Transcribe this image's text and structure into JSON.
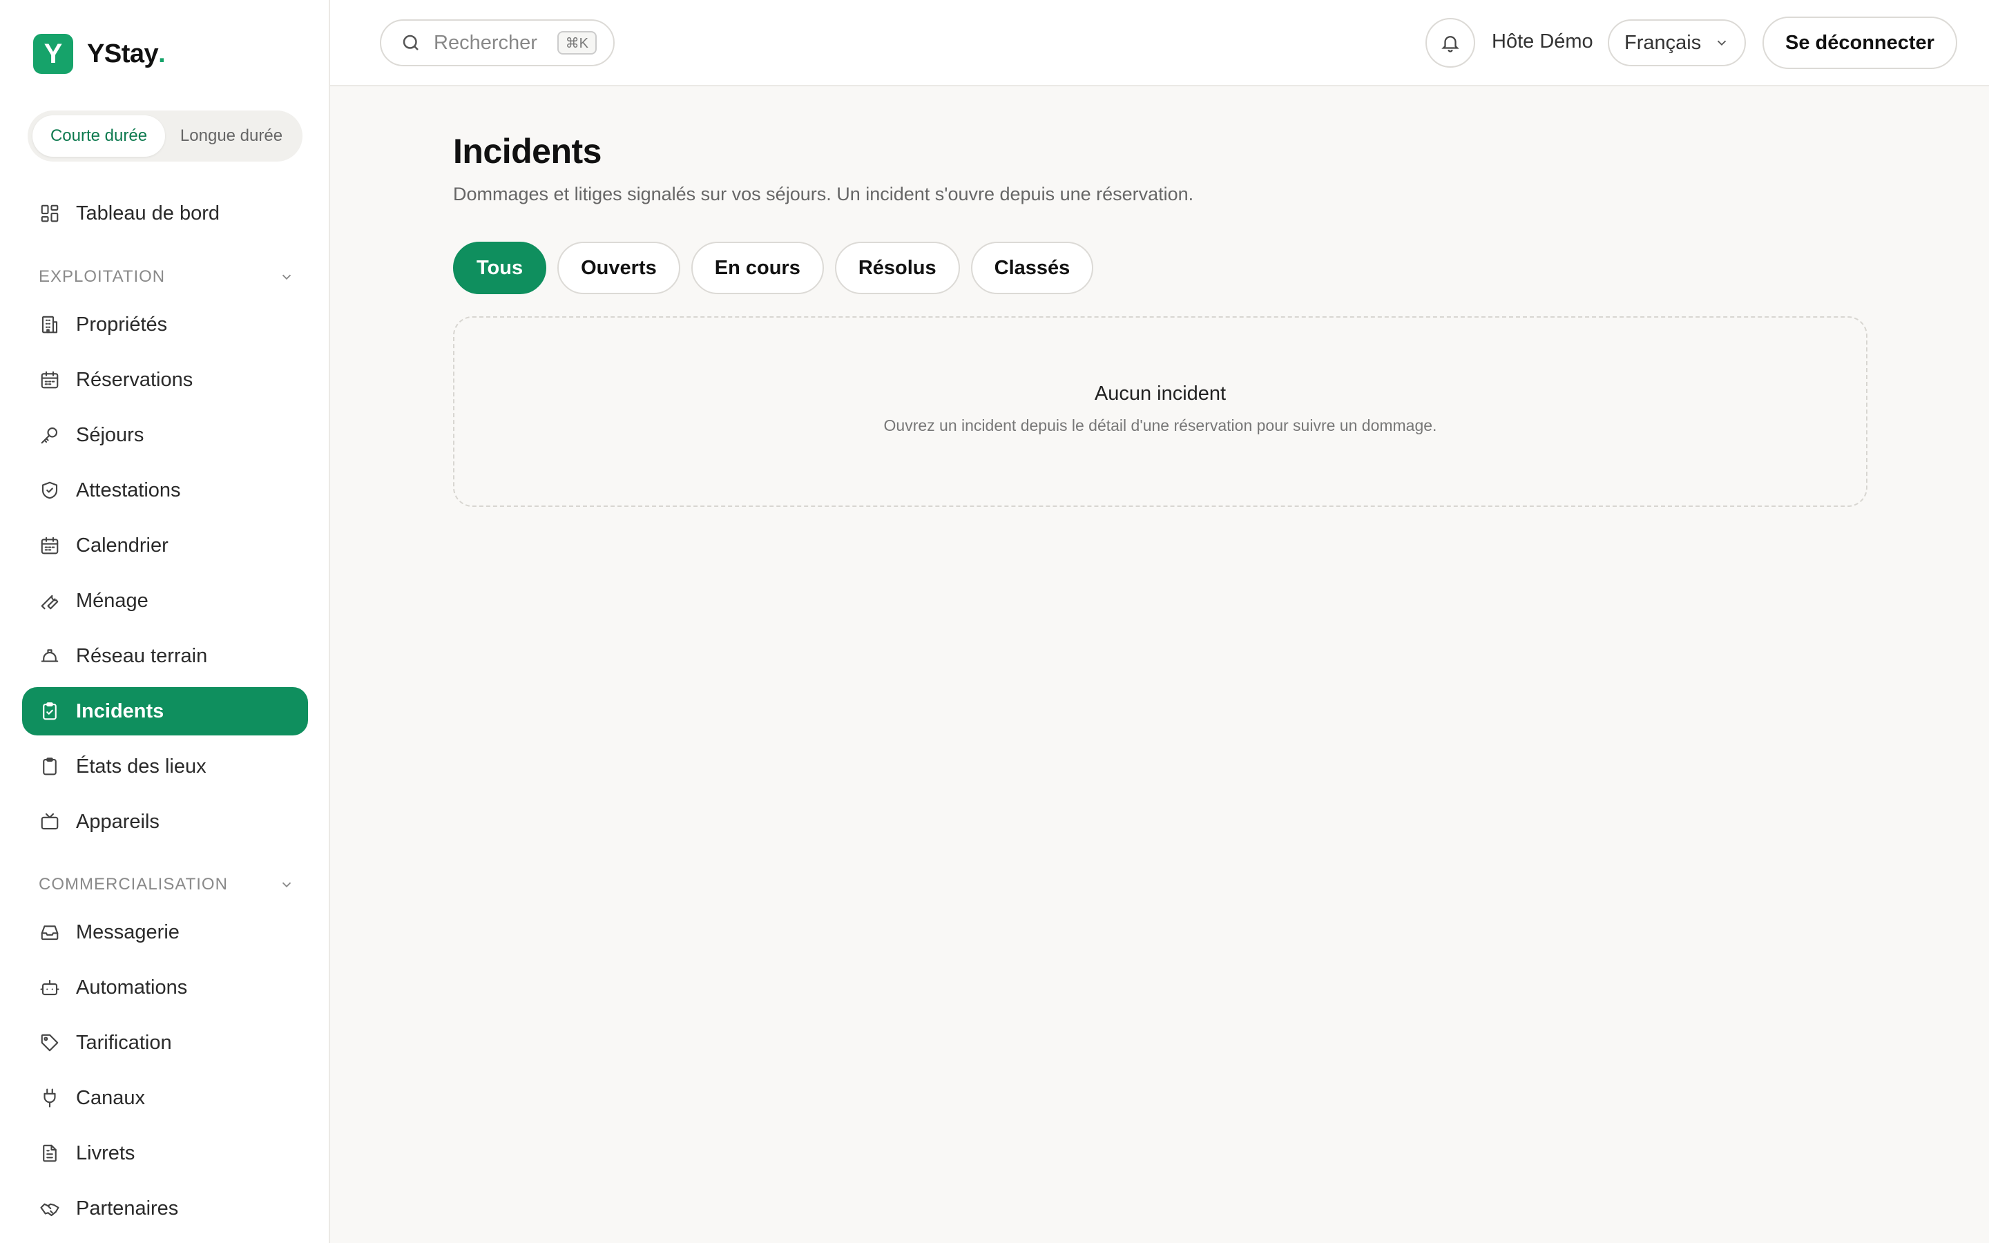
{
  "brand": {
    "logo_letter": "Y",
    "name": "YStay",
    "dot": "."
  },
  "mode_switch": {
    "short_term": "Courte durée",
    "long_term": "Longue durée"
  },
  "sidebar": {
    "dashboard": "Tableau de bord",
    "sections": {
      "exploitation": {
        "title": "EXPLOITATION",
        "items": [
          "Propriétés",
          "Réservations",
          "Séjours",
          "Attestations",
          "Calendrier",
          "Ménage",
          "Réseau terrain",
          "Incidents",
          "États des lieux",
          "Appareils"
        ]
      },
      "commercialisation": {
        "title": "COMMERCIALISATION",
        "items": [
          "Messagerie",
          "Automations",
          "Tarification",
          "Canaux",
          "Livrets",
          "Partenaires"
        ]
      }
    },
    "active_item": "Incidents"
  },
  "topbar": {
    "search_placeholder": "Rechercher",
    "search_shortcut": "⌘K",
    "user_name": "Hôte Démo",
    "language": "Français",
    "logout": "Se déconnecter"
  },
  "page": {
    "title": "Incidents",
    "subtitle": "Dommages et litiges signalés sur vos séjours. Un incident s'ouvre depuis une réservation.",
    "filters": [
      "Tous",
      "Ouverts",
      "En cours",
      "Résolus",
      "Classés"
    ],
    "active_filter": "Tous",
    "empty_title": "Aucun incident",
    "empty_description": "Ouvrez un incident depuis le détail d'une réservation pour suivre un dommage."
  },
  "colors": {
    "accent": "#0f8f5e",
    "brand": "#16a36a",
    "background": "#f9f8f6"
  }
}
